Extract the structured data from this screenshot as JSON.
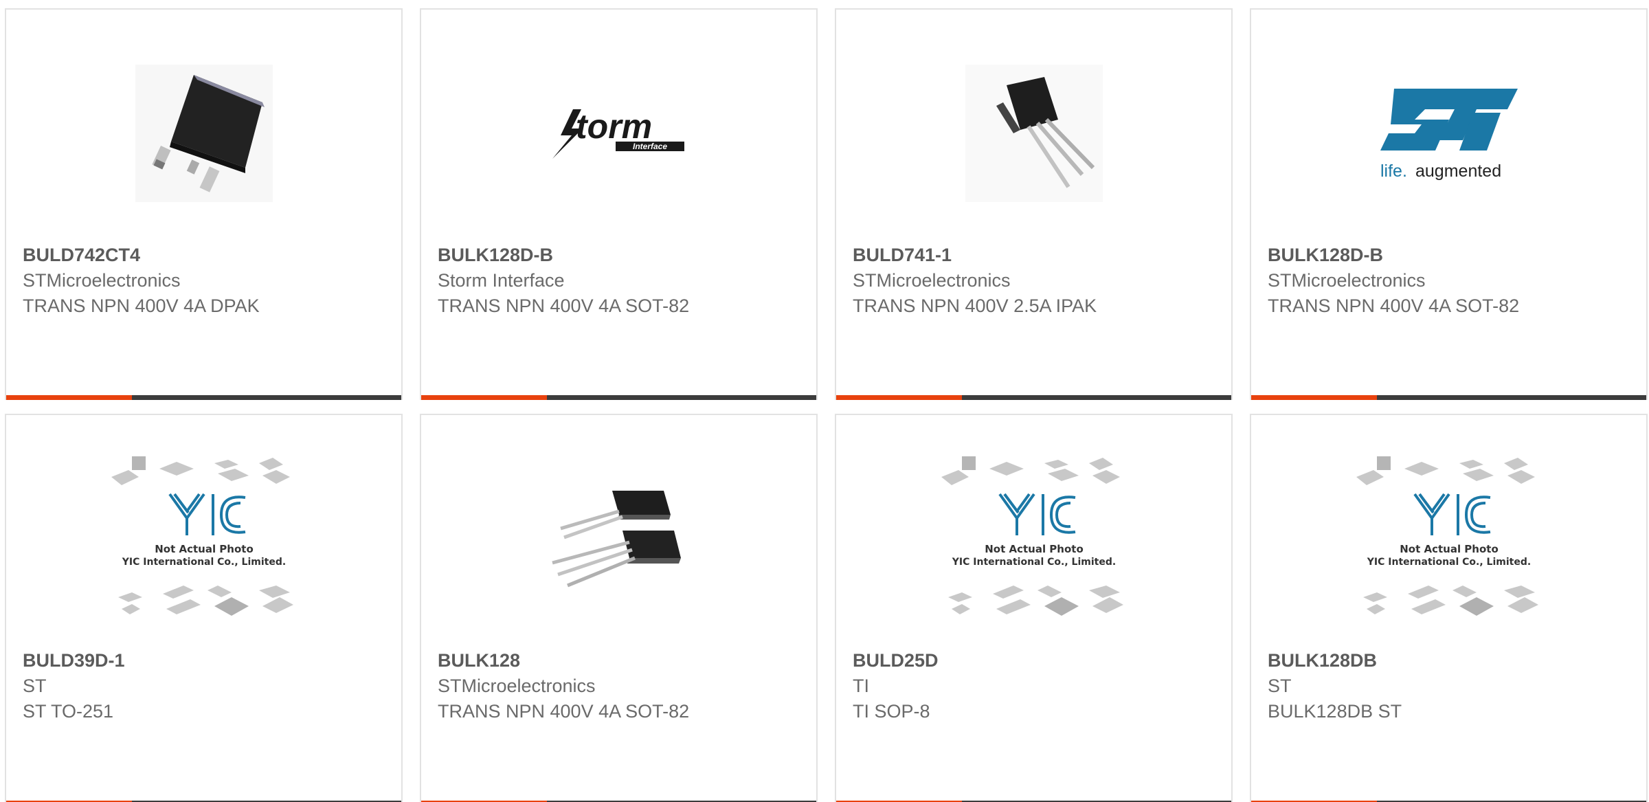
{
  "colors": {
    "accent": "#e8420e",
    "bar_dark": "#3c3c3c",
    "st_blue": "#1b78a6"
  },
  "products": [
    {
      "part": "BULD742CT4",
      "manufacturer": "STMicroelectronics",
      "description": "TRANS NPN 400V 4A DPAK",
      "image": "dpak-package-icon"
    },
    {
      "part": "BULK128D-B",
      "manufacturer": "Storm Interface",
      "description": "TRANS NPN 400V 4A SOT-82",
      "image": "storm-interface-logo",
      "logo_word": "torm",
      "logo_sub": "Interface"
    },
    {
      "part": "BULD741-1",
      "manufacturer": "STMicroelectronics",
      "description": "TRANS NPN 400V 2.5A IPAK",
      "image": "ipak-package-icon"
    },
    {
      "part": "BULK128D-B",
      "manufacturer": "STMicroelectronics",
      "description": "TRANS NPN 400V 4A SOT-82",
      "image": "st-logo",
      "logo_tagline_a": "life.",
      "logo_tagline_b": "augmented"
    },
    {
      "part": "BULD39D-1",
      "manufacturer": "ST",
      "description": "ST TO-251",
      "image": "not-actual-photo-placeholder",
      "ph_line1": "Not Actual Photo",
      "ph_line2": "YIC International Co., Limited."
    },
    {
      "part": "BULK128",
      "manufacturer": "STMicroelectronics",
      "description": "TRANS NPN 400V 4A SOT-82",
      "image": "sot82-package-icon"
    },
    {
      "part": "BULD25D",
      "manufacturer": "TI",
      "description": "TI SOP-8",
      "image": "not-actual-photo-placeholder",
      "ph_line1": "Not Actual Photo",
      "ph_line2": "YIC International Co., Limited."
    },
    {
      "part": "BULK128DB",
      "manufacturer": "ST",
      "description": "BULK128DB ST",
      "image": "not-actual-photo-placeholder",
      "ph_line1": "Not Actual Photo",
      "ph_line2": "YIC International Co., Limited."
    }
  ]
}
